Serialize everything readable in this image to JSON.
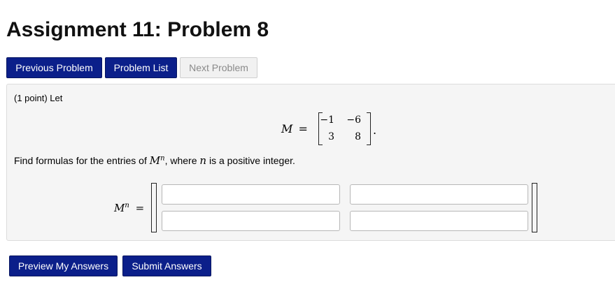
{
  "header": {
    "title": "Assignment 11: Problem 8"
  },
  "nav": {
    "previous_label": "Previous Problem",
    "list_label": "Problem List",
    "next_label": "Next Problem"
  },
  "problem": {
    "points_text": "(1 point) Let",
    "matrix_name": "M",
    "equals": "=",
    "matrix": [
      [
        "−1",
        "−6"
      ],
      [
        "3",
        "8"
      ]
    ],
    "period": ".",
    "find_prefix": "Find formulas for the entries of ",
    "find_var": "M",
    "find_exp": "n",
    "find_middle": ", where ",
    "find_n": "n",
    "find_suffix": " is a positive integer.",
    "answer_lhs_base": "M",
    "answer_lhs_exp": "n",
    "answer_lhs_equals": "=",
    "answers": [
      "",
      "",
      "",
      ""
    ]
  },
  "actions": {
    "preview_label": "Preview My Answers",
    "submit_label": "Submit Answers"
  },
  "colors": {
    "primary": "#0b1f8a",
    "disabled": "#f1f1f1",
    "panel": "#f5f5f5"
  }
}
